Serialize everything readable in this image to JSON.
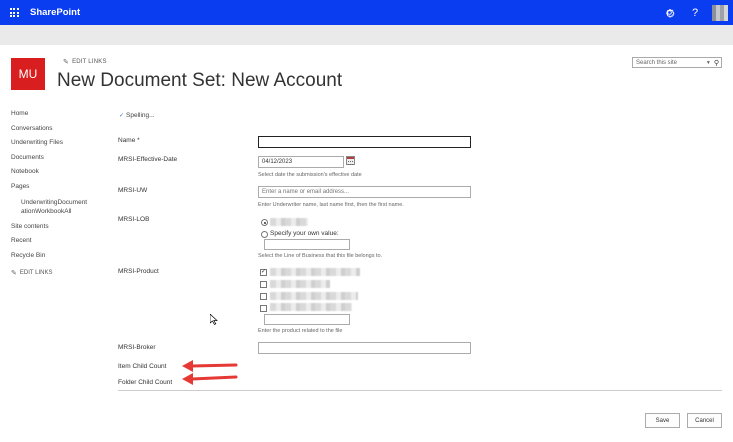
{
  "suitebar": {
    "brand": "SharePoint",
    "icons": [
      "waffle-icon",
      "gear-icon",
      "help-icon",
      "avatar"
    ],
    "help_glyph": "?",
    "bg_color": "#0a3cf0"
  },
  "header": {
    "logo_text": "MU",
    "logo_color": "#d81e1e",
    "edit_links": "EDIT LINKS",
    "title": "New Document Set: New Account",
    "search_placeholder": "Search this site"
  },
  "leftnav": {
    "items": [
      {
        "label": "Home"
      },
      {
        "label": "Conversations"
      },
      {
        "label": "Underwriting Files"
      },
      {
        "label": "Documents"
      },
      {
        "label": "Notebook"
      },
      {
        "label": "Pages"
      }
    ],
    "sub_item_line1": "UnderwritingDocument",
    "sub_item_line2": "ationWorkbookAll",
    "items_after": [
      {
        "label": "Site contents"
      },
      {
        "label": "Recent"
      },
      {
        "label": "Recycle Bin"
      }
    ],
    "edit_links": "EDIT LINKS"
  },
  "form": {
    "spelling": "Spelling...",
    "fields": {
      "name": {
        "label": "Name *",
        "value": ""
      },
      "effective_date": {
        "label": "MRSI-Effective-Date",
        "value": "04/12/2023",
        "hint": "Select date the submission's effective date"
      },
      "uw": {
        "label": "MRSI-UW",
        "placeholder": "Enter a name or email address...",
        "hint": "Enter Underwriter name, last name first, then the first name."
      },
      "lob": {
        "label": "MRSI-LOB",
        "specify_label": "Specify your own value:",
        "hint": "Select the Line of Business that this file belongs to."
      },
      "product": {
        "label": "MRSI-Product",
        "hint": "Enter the product related to the file"
      },
      "broker": {
        "label": "MRSI-Broker",
        "value": ""
      },
      "item_child_count": {
        "label": "Item Child Count"
      },
      "folder_child_count": {
        "label": "Folder Child Count"
      }
    },
    "annotation_arrow_color": "#e53935"
  },
  "buttons": {
    "save": "Save",
    "cancel": "Cancel"
  }
}
